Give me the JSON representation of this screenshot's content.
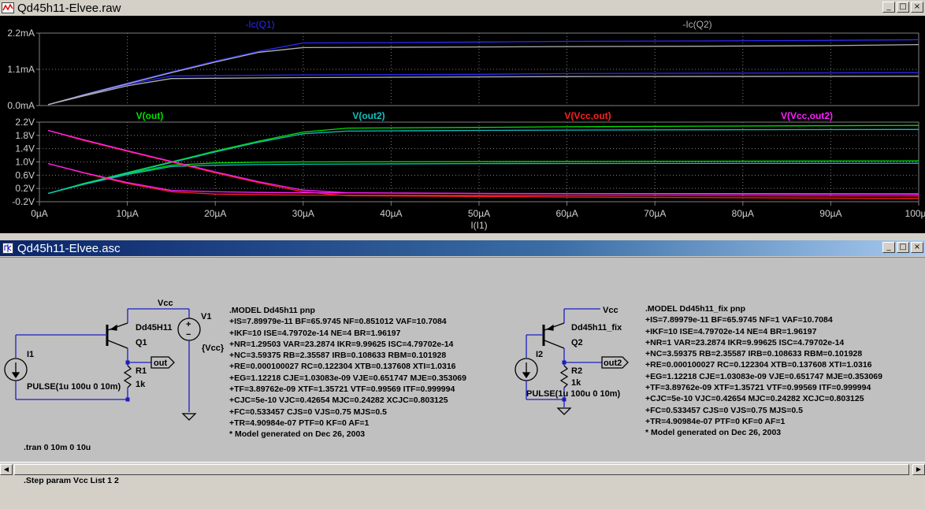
{
  "plot_window": {
    "title": "Qd45h11-Elvee.raw",
    "buttons": [
      "_",
      "□",
      "×"
    ]
  },
  "schematic_window": {
    "title": "Qd45h11-Elvee.asc",
    "buttons": [
      "_",
      "□",
      "×"
    ]
  },
  "colors": {
    "plot_bg": "#000000",
    "grid": "#808080",
    "axis_text": "#d0d0d0",
    "ic_q1": "#2a2aff",
    "ic_q2": "#b0b0b0",
    "v_out": "#00e000",
    "v_out2": "#10c0c0",
    "v_vcc_out": "#ff2020",
    "v_vcc_out2": "#ff20ff",
    "wire": "#1c1cbf"
  },
  "chart_data": [
    {
      "type": "line",
      "title": "",
      "xlabel": "I(I1)",
      "ylabel": "",
      "xlim": [
        0,
        100
      ],
      "x_unit": "µA",
      "ylim": [
        0,
        2.2
      ],
      "y_unit": "mA",
      "y_ticks": [
        "2.2mA",
        "1.1mA",
        "0.0mA"
      ],
      "x_ticks": [
        "0µA",
        "10µA",
        "20µA",
        "30µA",
        "40µA",
        "50µA",
        "60µA",
        "70µA",
        "80µA",
        "90µA",
        "100µA"
      ],
      "grid": true,
      "series": [
        {
          "name": "-Ic(Q1)",
          "step": "Vcc=2",
          "x": [
            1,
            5,
            10,
            15,
            20,
            25,
            30,
            40,
            50,
            60,
            75,
            90,
            100
          ],
          "values": [
            0.03,
            0.33,
            0.68,
            1.02,
            1.35,
            1.65,
            1.9,
            1.91,
            1.93,
            1.95,
            1.96,
            1.98,
            2.0
          ]
        },
        {
          "name": "-Ic(Q1)",
          "step": "Vcc=1",
          "x": [
            1,
            5,
            10,
            15,
            20,
            25,
            30,
            50,
            60,
            100
          ],
          "values": [
            0.03,
            0.3,
            0.64,
            0.9,
            0.91,
            0.92,
            0.93,
            0.95,
            0.97,
            1.0
          ]
        },
        {
          "name": "-Ic(Q2)",
          "step": "Vcc=2",
          "x": [
            1,
            5,
            10,
            15,
            20,
            25,
            30,
            40,
            50,
            60,
            75,
            90,
            100
          ],
          "values": [
            0.03,
            0.32,
            0.66,
            1.0,
            1.32,
            1.62,
            1.76,
            1.77,
            1.78,
            1.79,
            1.8,
            1.82,
            1.85
          ]
        },
        {
          "name": "-Ic(Q2)",
          "step": "Vcc=1",
          "x": [
            1,
            5,
            10,
            15,
            20,
            25,
            30,
            50,
            60,
            100
          ],
          "values": [
            0.03,
            0.29,
            0.6,
            0.82,
            0.83,
            0.84,
            0.85,
            0.87,
            0.88,
            0.89
          ]
        }
      ]
    },
    {
      "type": "line",
      "title": "",
      "xlabel": "I(I1)",
      "ylabel": "",
      "xlim": [
        0,
        100
      ],
      "x_unit": "µA",
      "ylim": [
        -0.2,
        2.2
      ],
      "y_unit": "V",
      "y_ticks": [
        "2.2V",
        "1.8V",
        "1.4V",
        "1.0V",
        "0.6V",
        "0.2V",
        "-0.2V"
      ],
      "grid": true,
      "series": [
        {
          "name": "V(out)",
          "step": "Vcc=2",
          "x": [
            1,
            5,
            10,
            15,
            20,
            25,
            30,
            35,
            50,
            60,
            75,
            100
          ],
          "values": [
            0.05,
            0.35,
            0.68,
            1.0,
            1.33,
            1.63,
            1.9,
            2.02,
            2.04,
            2.06,
            2.08,
            2.1
          ]
        },
        {
          "name": "V(out)",
          "step": "Vcc=1",
          "x": [
            1,
            5,
            10,
            15,
            20,
            25,
            30,
            50,
            100
          ],
          "values": [
            0.05,
            0.33,
            0.65,
            0.9,
            0.97,
            0.99,
            1.0,
            1.01,
            1.03
          ]
        },
        {
          "name": "V(out2)",
          "step": "Vcc=2",
          "x": [
            1,
            5,
            10,
            15,
            20,
            25,
            30,
            35,
            50,
            60,
            75,
            100
          ],
          "values": [
            0.05,
            0.33,
            0.66,
            0.98,
            1.3,
            1.6,
            1.85,
            1.93,
            1.95,
            1.96,
            1.97,
            1.98
          ]
        },
        {
          "name": "V(out2)",
          "step": "Vcc=1",
          "x": [
            1,
            5,
            10,
            15,
            20,
            25,
            30,
            50,
            100
          ],
          "values": [
            0.05,
            0.32,
            0.62,
            0.86,
            0.9,
            0.92,
            0.93,
            0.95,
            0.96
          ]
        },
        {
          "name": "V(Vcc,out)",
          "step": "Vcc=2",
          "x": [
            1,
            5,
            10,
            15,
            20,
            25,
            30,
            35,
            50,
            60,
            100
          ],
          "values": [
            1.95,
            1.65,
            1.32,
            1.0,
            0.67,
            0.37,
            0.1,
            -0.02,
            -0.04,
            -0.06,
            -0.1
          ]
        },
        {
          "name": "V(Vcc,out)",
          "step": "Vcc=1",
          "x": [
            1,
            5,
            10,
            15,
            20,
            25,
            30,
            50,
            100
          ],
          "values": [
            0.95,
            0.67,
            0.35,
            0.1,
            0.03,
            0.01,
            0.0,
            -0.01,
            -0.03
          ]
        },
        {
          "name": "V(Vcc,out2)",
          "step": "Vcc=2",
          "x": [
            1,
            5,
            10,
            15,
            20,
            25,
            30,
            35,
            50,
            60,
            100
          ],
          "values": [
            1.95,
            1.67,
            1.34,
            1.02,
            0.7,
            0.4,
            0.15,
            0.07,
            0.05,
            0.04,
            0.02
          ]
        },
        {
          "name": "V(Vcc,out2)",
          "step": "Vcc=1",
          "x": [
            1,
            5,
            10,
            15,
            20,
            25,
            30,
            50,
            100
          ],
          "values": [
            0.95,
            0.68,
            0.38,
            0.14,
            0.1,
            0.08,
            0.07,
            0.05,
            0.04
          ]
        }
      ]
    }
  ],
  "legend_top": [
    {
      "label": "-Ic(Q1)",
      "color": "#2a2aff"
    },
    {
      "label": "-Ic(Q2)",
      "color": "#b0b0b0"
    }
  ],
  "legend_bottom": [
    {
      "label": "V(out)",
      "color": "#00e000"
    },
    {
      "label": "V(out2)",
      "color": "#10c0c0"
    },
    {
      "label": "V(Vcc,out)",
      "color": "#ff2020"
    },
    {
      "label": "V(Vcc,out2)",
      "color": "#ff20ff"
    }
  ],
  "schematic": {
    "circuit1": {
      "vcc": "Vcc",
      "v1": "V1",
      "v1_value": "{Vcc}",
      "plus": "+",
      "minus": "−",
      "q_model": "Dd45H11",
      "q_name": "Q1",
      "i_name": "I1",
      "r_name": "R1",
      "r_value": "1k",
      "out_label": "out",
      "pulse": "PULSE(1u 100u 0 10m)"
    },
    "circuit2": {
      "vcc": "Vcc",
      "q_model": "Dd45h11_fix",
      "q_name": "Q2",
      "i_name": "I2",
      "r_name": "R2",
      "r_value": "1k",
      "out_label": "out2",
      "pulse": "PULSE(1u 100u 0 10m)"
    },
    "directives": [
      ".tran 0 10m 0 10u",
      ".Step param Vcc List 1 2"
    ],
    "model1": [
      ".MODEL Dd45h11 pnp",
      "+IS=7.89979e-11 BF=65.9745 NF=0.851012 VAF=10.7084",
      "+IKF=10 ISE=4.79702e-14 NE=4 BR=1.96197",
      "+NR=1.29503 VAR=23.2874 IKR=9.99625 ISC=4.79702e-14",
      "+NC=3.59375 RB=2.35587 IRB=0.108633 RBM=0.101928",
      "+RE=0.000100027 RC=0.122304 XTB=0.137608 XTI=1.0316",
      "+EG=1.12218 CJE=1.03083e-09 VJE=0.651747 MJE=0.353069",
      "+TF=3.89762e-09 XTF=1.35721 VTF=0.99569 ITF=0.999994",
      "+CJC=5e-10 VJC=0.42654 MJC=0.24282 XCJC=0.803125",
      "+FC=0.533457 CJS=0 VJS=0.75 MJS=0.5",
      "+TR=4.90984e-07 PTF=0 KF=0 AF=1",
      "* Model generated on Dec 26, 2003"
    ],
    "model2": [
      ".MODEL Dd45h11_fix pnp",
      "+IS=7.89979e-11 BF=65.9745 NF=1 VAF=10.7084",
      "+IKF=10 ISE=4.79702e-14 NE=4 BR=1.96197",
      "+NR=1 VAR=23.2874 IKR=9.99625 ISC=4.79702e-14",
      "+NC=3.59375 RB=2.35587 IRB=0.108633 RBM=0.101928",
      "+RE=0.000100027 RC=0.122304 XTB=0.137608 XTI=1.0316",
      "+EG=1.12218 CJE=1.03083e-09 VJE=0.651747 MJE=0.353069",
      "+TF=3.89762e-09 XTF=1.35721 VTF=0.99569 ITF=0.999994",
      "+CJC=5e-10 VJC=0.42654 MJC=0.24282 XCJC=0.803125",
      "+FC=0.533457 CJS=0 VJS=0.75 MJS=0.5",
      "+TR=4.90984e-07 PTF=0 KF=0 AF=1",
      "* Model generated on Dec 26, 2003"
    ]
  }
}
